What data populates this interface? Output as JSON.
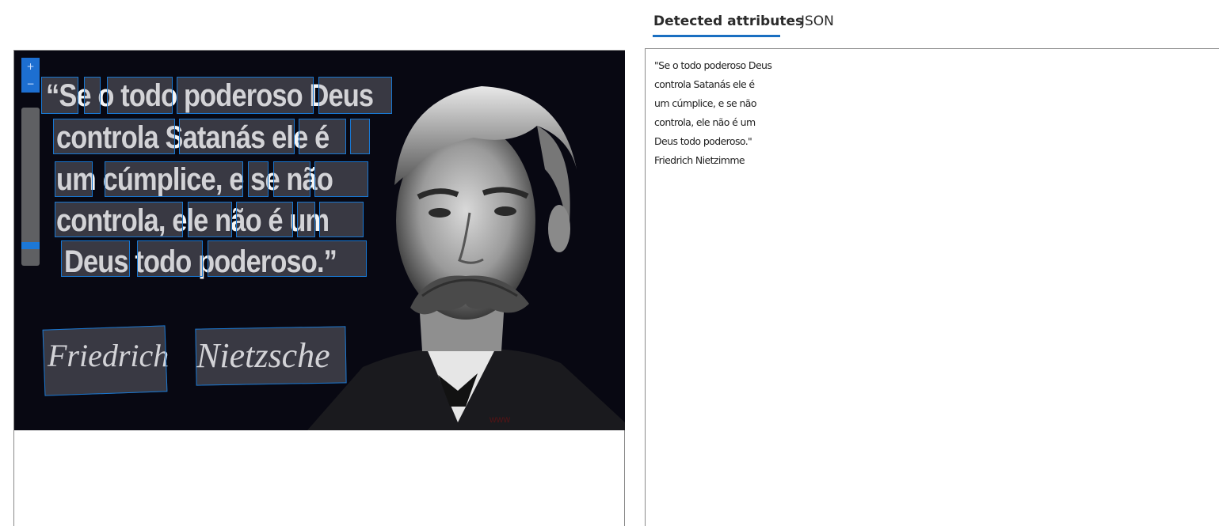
{
  "tabs": [
    {
      "label": "Detected attributes",
      "active": true
    },
    {
      "label": "JSON",
      "active": false
    }
  ],
  "image": {
    "quote_lines": [
      "“Se o todo poderoso Deus",
      "controla Satanás ele é",
      "um cúmplice, e se não",
      "controla, ele não é um",
      "Deus todo poderoso.”"
    ],
    "signature": [
      "Friedrich",
      "Nietzsche"
    ]
  },
  "zoom": {
    "in_label": "+",
    "out_label": "−",
    "level": 0.1
  },
  "result": {
    "lines": [
      "\"Se o todo poderoso Deus",
      "controla Satanás ele é",
      "um cúmplice, e se não",
      "controla, ele não é um",
      "Deus todo poderoso.\"",
      "Friedrich Nietzimme"
    ]
  },
  "colors": {
    "bbox": "#1877d2",
    "accent": "#1a6fc1",
    "photo_bg": "#080812"
  }
}
